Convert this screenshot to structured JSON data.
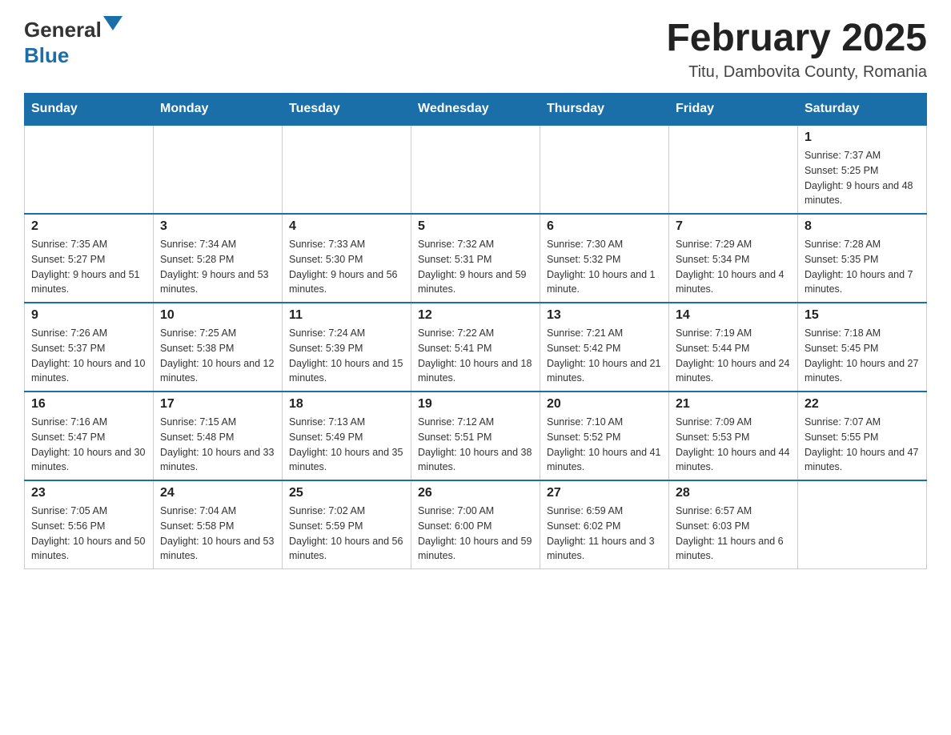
{
  "header": {
    "logo_general": "General",
    "logo_blue": "Blue",
    "title": "February 2025",
    "location": "Titu, Dambovita County, Romania"
  },
  "days_of_week": [
    "Sunday",
    "Monday",
    "Tuesday",
    "Wednesday",
    "Thursday",
    "Friday",
    "Saturday"
  ],
  "weeks": [
    [
      {
        "day": "",
        "info": ""
      },
      {
        "day": "",
        "info": ""
      },
      {
        "day": "",
        "info": ""
      },
      {
        "day": "",
        "info": ""
      },
      {
        "day": "",
        "info": ""
      },
      {
        "day": "",
        "info": ""
      },
      {
        "day": "1",
        "info": "Sunrise: 7:37 AM\nSunset: 5:25 PM\nDaylight: 9 hours and 48 minutes."
      }
    ],
    [
      {
        "day": "2",
        "info": "Sunrise: 7:35 AM\nSunset: 5:27 PM\nDaylight: 9 hours and 51 minutes."
      },
      {
        "day": "3",
        "info": "Sunrise: 7:34 AM\nSunset: 5:28 PM\nDaylight: 9 hours and 53 minutes."
      },
      {
        "day": "4",
        "info": "Sunrise: 7:33 AM\nSunset: 5:30 PM\nDaylight: 9 hours and 56 minutes."
      },
      {
        "day": "5",
        "info": "Sunrise: 7:32 AM\nSunset: 5:31 PM\nDaylight: 9 hours and 59 minutes."
      },
      {
        "day": "6",
        "info": "Sunrise: 7:30 AM\nSunset: 5:32 PM\nDaylight: 10 hours and 1 minute."
      },
      {
        "day": "7",
        "info": "Sunrise: 7:29 AM\nSunset: 5:34 PM\nDaylight: 10 hours and 4 minutes."
      },
      {
        "day": "8",
        "info": "Sunrise: 7:28 AM\nSunset: 5:35 PM\nDaylight: 10 hours and 7 minutes."
      }
    ],
    [
      {
        "day": "9",
        "info": "Sunrise: 7:26 AM\nSunset: 5:37 PM\nDaylight: 10 hours and 10 minutes."
      },
      {
        "day": "10",
        "info": "Sunrise: 7:25 AM\nSunset: 5:38 PM\nDaylight: 10 hours and 12 minutes."
      },
      {
        "day": "11",
        "info": "Sunrise: 7:24 AM\nSunset: 5:39 PM\nDaylight: 10 hours and 15 minutes."
      },
      {
        "day": "12",
        "info": "Sunrise: 7:22 AM\nSunset: 5:41 PM\nDaylight: 10 hours and 18 minutes."
      },
      {
        "day": "13",
        "info": "Sunrise: 7:21 AM\nSunset: 5:42 PM\nDaylight: 10 hours and 21 minutes."
      },
      {
        "day": "14",
        "info": "Sunrise: 7:19 AM\nSunset: 5:44 PM\nDaylight: 10 hours and 24 minutes."
      },
      {
        "day": "15",
        "info": "Sunrise: 7:18 AM\nSunset: 5:45 PM\nDaylight: 10 hours and 27 minutes."
      }
    ],
    [
      {
        "day": "16",
        "info": "Sunrise: 7:16 AM\nSunset: 5:47 PM\nDaylight: 10 hours and 30 minutes."
      },
      {
        "day": "17",
        "info": "Sunrise: 7:15 AM\nSunset: 5:48 PM\nDaylight: 10 hours and 33 minutes."
      },
      {
        "day": "18",
        "info": "Sunrise: 7:13 AM\nSunset: 5:49 PM\nDaylight: 10 hours and 35 minutes."
      },
      {
        "day": "19",
        "info": "Sunrise: 7:12 AM\nSunset: 5:51 PM\nDaylight: 10 hours and 38 minutes."
      },
      {
        "day": "20",
        "info": "Sunrise: 7:10 AM\nSunset: 5:52 PM\nDaylight: 10 hours and 41 minutes."
      },
      {
        "day": "21",
        "info": "Sunrise: 7:09 AM\nSunset: 5:53 PM\nDaylight: 10 hours and 44 minutes."
      },
      {
        "day": "22",
        "info": "Sunrise: 7:07 AM\nSunset: 5:55 PM\nDaylight: 10 hours and 47 minutes."
      }
    ],
    [
      {
        "day": "23",
        "info": "Sunrise: 7:05 AM\nSunset: 5:56 PM\nDaylight: 10 hours and 50 minutes."
      },
      {
        "day": "24",
        "info": "Sunrise: 7:04 AM\nSunset: 5:58 PM\nDaylight: 10 hours and 53 minutes."
      },
      {
        "day": "25",
        "info": "Sunrise: 7:02 AM\nSunset: 5:59 PM\nDaylight: 10 hours and 56 minutes."
      },
      {
        "day": "26",
        "info": "Sunrise: 7:00 AM\nSunset: 6:00 PM\nDaylight: 10 hours and 59 minutes."
      },
      {
        "day": "27",
        "info": "Sunrise: 6:59 AM\nSunset: 6:02 PM\nDaylight: 11 hours and 3 minutes."
      },
      {
        "day": "28",
        "info": "Sunrise: 6:57 AM\nSunset: 6:03 PM\nDaylight: 11 hours and 6 minutes."
      },
      {
        "day": "",
        "info": ""
      }
    ]
  ]
}
